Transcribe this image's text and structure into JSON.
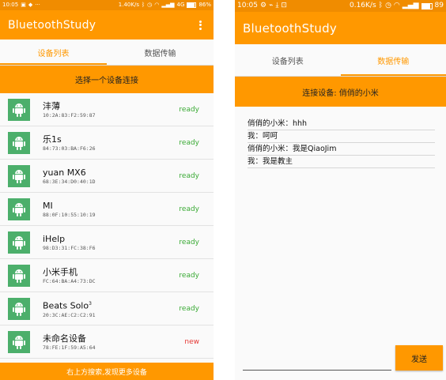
{
  "colors": {
    "accent": "#ff9800",
    "status_bar": "#f08c00",
    "android_green": "#4caf6b",
    "ready": "#3aaa35",
    "new": "#e53935"
  },
  "left": {
    "statusbar": {
      "time": "10:05",
      "speed": "1.40K/s",
      "network": "4G",
      "battery": "86%",
      "battery_level": 0.86
    },
    "appbar": {
      "title": "BluetoothStudy",
      "menu_icon": "overflow-menu-icon"
    },
    "tabs": [
      {
        "label": "设备列表",
        "active": true
      },
      {
        "label": "数据传输",
        "active": false
      }
    ],
    "banner": "选择一个设备连接",
    "devices": [
      {
        "name": "沣薄",
        "mac": "10:2A:83:F2:59:87",
        "status": "ready",
        "icon": "android-icon"
      },
      {
        "name": "乐1s",
        "mac": "84:73:03:BA:F6:26",
        "status": "ready",
        "icon": "android-icon"
      },
      {
        "name": "yuan MX6",
        "mac": "68:3E:34:D0:40:1D",
        "status": "ready",
        "icon": "android-icon"
      },
      {
        "name": "MI",
        "mac": "88:0F:10:55:10:19",
        "status": "ready",
        "icon": "android-icon"
      },
      {
        "name": "iHelp",
        "mac": "98:D3:31:FC:38:F6",
        "status": "ready",
        "icon": "android-icon"
      },
      {
        "name": "小米手机",
        "mac": "FC:64:BA:A4:73:DC",
        "status": "ready",
        "icon": "android-icon"
      },
      {
        "name": "Beats Solo",
        "name_sup": "3",
        "mac": "20:3C:AE:C2:C2:91",
        "status": "ready",
        "icon": "android-icon"
      },
      {
        "name": "未命名设备",
        "mac": "78:FE:1F:59:A5:64",
        "status": "new",
        "icon": "android-icon"
      }
    ],
    "bottom_hint": "右上方搜索,发现更多设备"
  },
  "right": {
    "statusbar": {
      "time": "10:05",
      "speed": "0.16K/s",
      "battery": "89",
      "battery_level": 0.89
    },
    "appbar": {
      "title": "BluetoothStudy"
    },
    "tabs": [
      {
        "label": "设备列表",
        "active": false
      },
      {
        "label": "数据传输",
        "active": true
      }
    ],
    "banner": "连接设备: 俏俏的小米",
    "messages": [
      "俏俏的小米：hhh",
      "我：呵呵",
      "俏俏的小米：我是QiaoJim",
      "我：我是教主"
    ],
    "input": {
      "value": "",
      "placeholder": ""
    },
    "send_label": "发送"
  }
}
